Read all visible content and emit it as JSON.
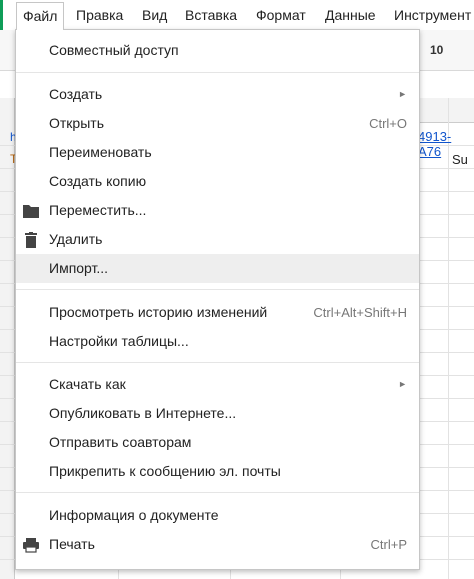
{
  "menubar": {
    "items": [
      "Файл",
      "Правка",
      "Вид",
      "Вставка",
      "Формат",
      "Данные",
      "Инструмент"
    ]
  },
  "toolbar": {
    "font_size": "10"
  },
  "sheet": {
    "link_cell": "4913-A76",
    "text_cell": "Su",
    "left_fragment_1": "h",
    "left_fragment_2": "T"
  },
  "file_menu": {
    "share": "Совместный доступ",
    "create": "Создать",
    "open": "Открыть",
    "open_shortcut": "Ctrl+O",
    "rename": "Переименовать",
    "make_copy": "Создать копию",
    "move": "Переместить...",
    "delete": "Удалить",
    "import": "Импорт...",
    "history": "Просмотреть историю изменений",
    "history_shortcut": "Ctrl+Alt+Shift+H",
    "settings": "Настройки таблицы...",
    "download": "Скачать как",
    "publish": "Опубликовать в Интернете...",
    "email_collaborators": "Отправить соавторам",
    "email_attach": "Прикрепить к сообщению эл. почты",
    "doc_info": "Информация о документе",
    "print": "Печать",
    "print_shortcut": "Ctrl+P"
  }
}
